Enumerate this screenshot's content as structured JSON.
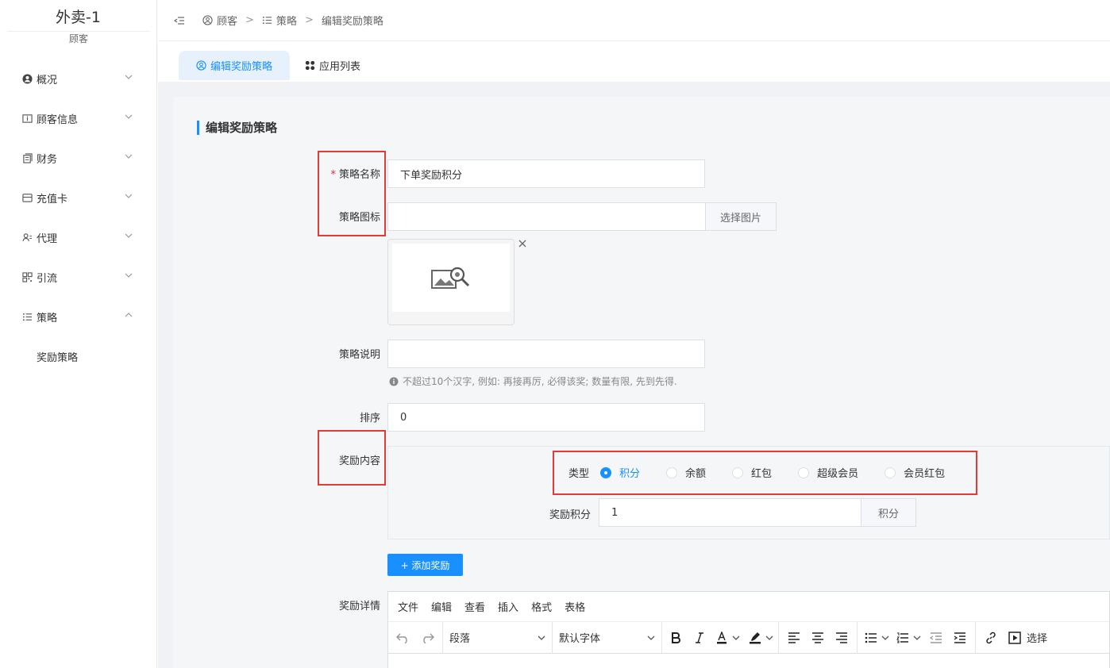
{
  "sidebar": {
    "brand_title": "外卖-1",
    "brand_sub": "顾客",
    "items": [
      {
        "label": "概况",
        "icon": "user-circle-icon"
      },
      {
        "label": "顾客信息",
        "icon": "folder-info-icon"
      },
      {
        "label": "财务",
        "icon": "finance-icon"
      },
      {
        "label": "充值卡",
        "icon": "card-icon"
      },
      {
        "label": "代理",
        "icon": "agent-icon"
      },
      {
        "label": "引流",
        "icon": "qrcode-icon"
      },
      {
        "label": "策略",
        "icon": "list-icon"
      }
    ],
    "sub_items": [
      {
        "label": "奖励策略"
      }
    ]
  },
  "breadcrumb": {
    "items": [
      "顾客",
      "策略",
      "编辑奖励策略"
    ],
    "separator": ">"
  },
  "tabs": [
    {
      "label": "编辑奖励策略",
      "active": true
    },
    {
      "label": "应用列表",
      "active": false
    }
  ],
  "form": {
    "section_title": "编辑奖励策略",
    "name_label": "策略名称",
    "name_value": "下单奖励积分",
    "icon_label": "策略图标",
    "icon_value": "",
    "select_image_label": "选择图片",
    "desc_label": "策略说明",
    "desc_value": "",
    "desc_hint": "不超过10个汉字, 例如: 再接再厉, 必得该奖; 数量有限, 先到先得.",
    "sort_label": "排序",
    "sort_value": "0",
    "reward_label": "奖励内容",
    "type_label": "类型",
    "type_options": [
      "积分",
      "余额",
      "红包",
      "超级会员",
      "会员红包"
    ],
    "type_selected": "积分",
    "reward_points_label": "奖励积分",
    "reward_points_value": "1",
    "reward_points_unit": "积分",
    "add_reward_label": "+ 添加奖励",
    "detail_label": "奖励详情"
  },
  "editor": {
    "menu": [
      "文件",
      "编辑",
      "查看",
      "插入",
      "格式",
      "表格"
    ],
    "paragraph": "段落",
    "font": "默认字体",
    "choose_label": "选择"
  },
  "colors": {
    "primary": "#1890ff",
    "highlight_box": "#e53935",
    "required": "#f5222d"
  }
}
